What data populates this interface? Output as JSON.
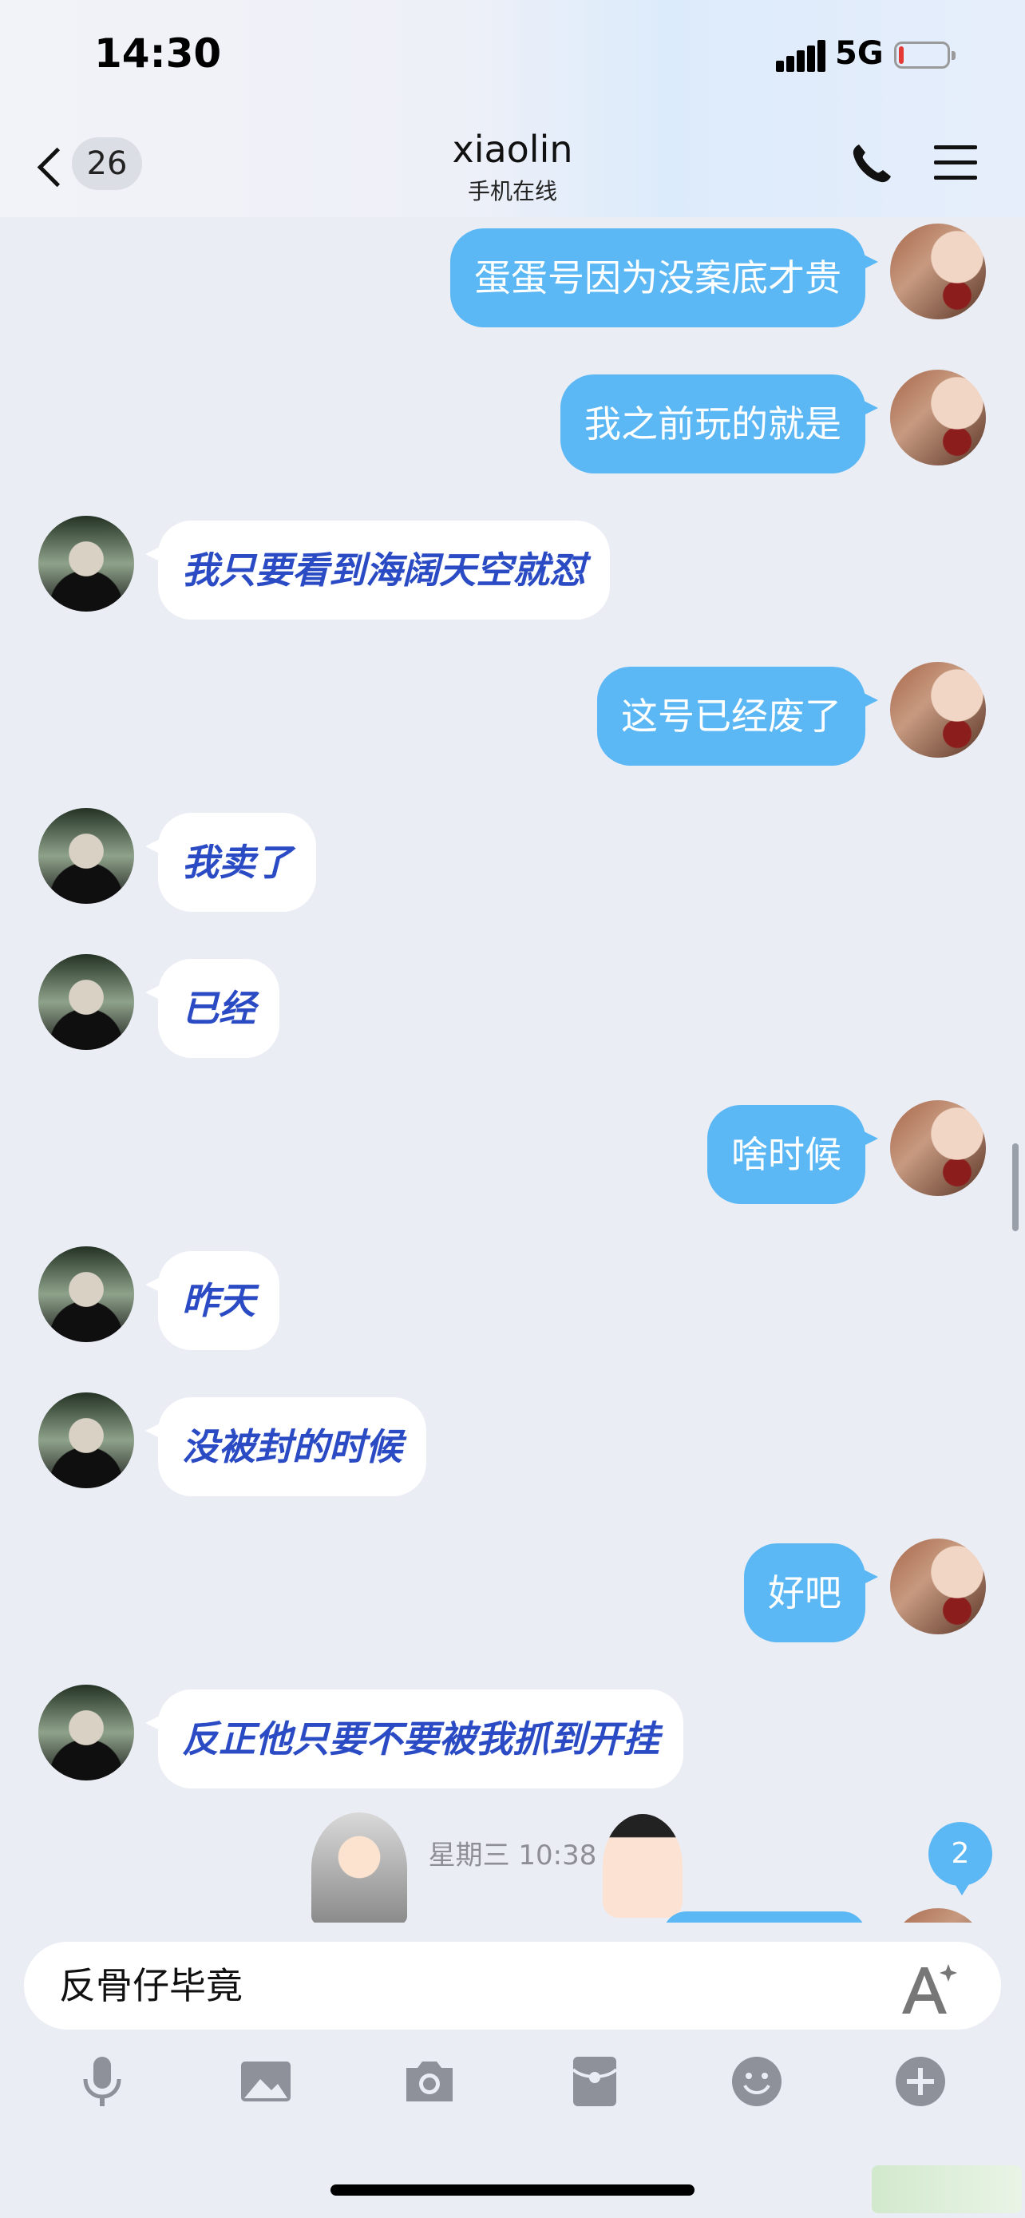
{
  "status_bar": {
    "time": "14:30",
    "network": "5G"
  },
  "header": {
    "unread_count": "26",
    "title": "xiaolin",
    "subtitle": "手机在线"
  },
  "messages": [
    {
      "from": "me",
      "text": "蛋蛋号因为没案底才贵"
    },
    {
      "from": "me",
      "text": "我之前玩的就是"
    },
    {
      "from": "them",
      "text": "我只要看到海阔天空就怼"
    },
    {
      "from": "me",
      "text": "这号已经废了"
    },
    {
      "from": "them",
      "text": "我卖了"
    },
    {
      "from": "them",
      "text": "已经"
    },
    {
      "from": "me",
      "text": "啥时候"
    },
    {
      "from": "them",
      "text": "昨天"
    },
    {
      "from": "them",
      "text": "没被封的时候"
    },
    {
      "from": "me",
      "text": "好吧"
    },
    {
      "from": "them",
      "text": "反正他只要不要被我抓到开挂"
    }
  ],
  "timestamp": "星期三 10:38",
  "new_message_badge": "2",
  "input": {
    "text": "反骨仔毕竟"
  },
  "toolbar_icons": [
    "microphone-icon",
    "image-icon",
    "camera-icon",
    "red-packet-icon",
    "emoji-icon",
    "plus-icon"
  ],
  "colors": {
    "outgoing_bubble": "#5cb8f4",
    "incoming_text": "#2a4bc4",
    "background": "#ebedf5"
  }
}
